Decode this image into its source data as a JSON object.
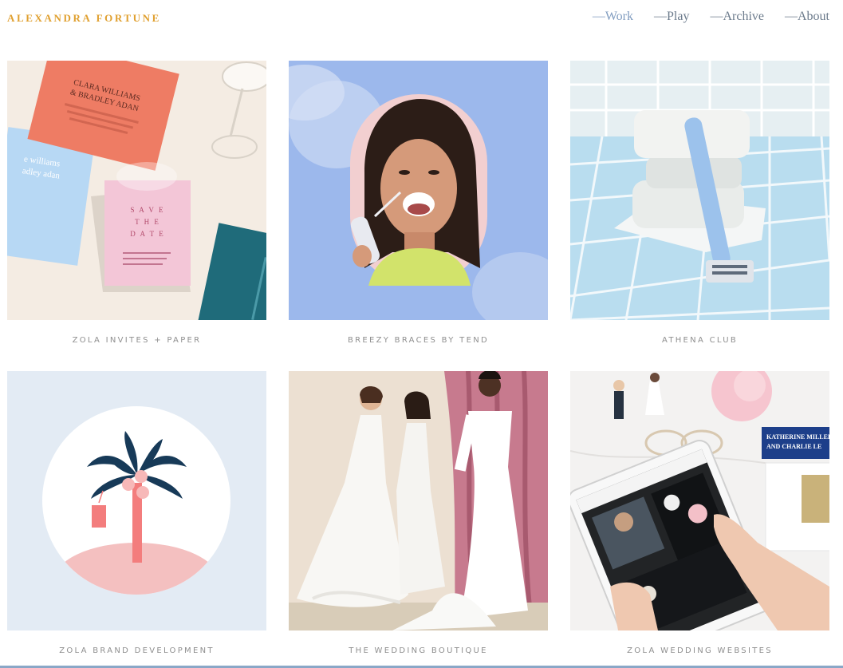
{
  "header": {
    "logo": "ALEXANDRA FORTUNE",
    "nav": [
      {
        "label": "—Work"
      },
      {
        "label": "—Play"
      },
      {
        "label": "—Archive"
      },
      {
        "label": "—About"
      }
    ]
  },
  "projects": [
    {
      "title": "ZOLA INVITES + PAPER",
      "image_icon": "wedding-invitation-photo",
      "card_text": {
        "names1": "CLARA WILLIAMS",
        "names2": "& BRADLEY ADAN",
        "save": [
          "S A V E",
          "T H E",
          "D A T E"
        ],
        "side1": "e williams",
        "side2": "adley adan"
      }
    },
    {
      "title": "BREEZY BRACES BY TEND",
      "image_icon": "smiling-woman-portrait-photo"
    },
    {
      "title": "ATHENA CLUB",
      "image_icon": "razor-and-soap-photo"
    },
    {
      "title": "ZOLA BRAND DEVELOPMENT",
      "image_icon": "palm-tree-illustration"
    },
    {
      "title": "THE WEDDING BOUTIQUE",
      "image_icon": "wedding-dresses-photo"
    },
    {
      "title": "ZOLA WEDDING WEBSITES",
      "image_icon": "tablet-wedding-website-photo",
      "card_text": {
        "katherine": "KATHERINE MILLER",
        "charlie": "AND CHARLIE LE"
      }
    }
  ],
  "colors": {
    "logo": "#e0a030",
    "nav": "#6b7a8b",
    "nav_active": "#7f9bbf",
    "caption": "#8f8f8f",
    "accent_line": "#8aa7c7"
  }
}
